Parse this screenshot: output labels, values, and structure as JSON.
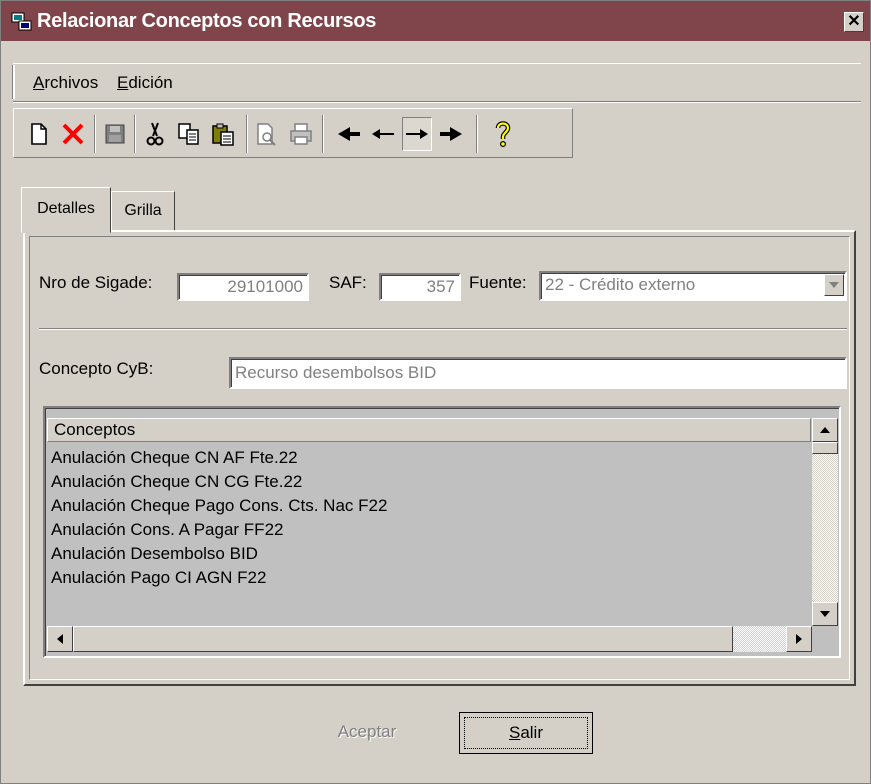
{
  "window": {
    "title": "Relacionar Conceptos con Recursos",
    "close_glyph": "✕"
  },
  "menu": {
    "archivos": {
      "mnemonic": "A",
      "rest": "rchivos"
    },
    "edicion": {
      "mnemonic": "E",
      "rest": "dición"
    }
  },
  "toolbar_icons": [
    "new-document-icon",
    "delete-icon",
    "save-icon",
    "cut-icon",
    "copy-icon",
    "paste-icon",
    "print-preview-icon",
    "print-icon",
    "first-record-icon",
    "previous-record-icon",
    "next-record-icon",
    "last-record-icon",
    "help-icon"
  ],
  "tabs": {
    "detalles": "Detalles",
    "grilla": "Grilla"
  },
  "form": {
    "nro_sigade_label": "Nro de Sigade:",
    "nro_sigade_value": "29101000",
    "saf_label": "SAF:",
    "saf_value": "357",
    "fuente_label": "Fuente:",
    "fuente_value": "22 - Crédito externo",
    "concepto_label": "Concepto CyB:",
    "concepto_value": "Recurso desembolsos BID"
  },
  "grid": {
    "header": "Conceptos",
    "rows": [
      "Anulación Cheque CN AF Fte.22",
      "Anulación Cheque CN CG Fte.22",
      "Anulación Cheque Pago Cons. Cts. Nac F22",
      "Anulación Cons. A Pagar FF22",
      "Anulación Desembolso BID",
      "Anulación Pago CI AGN F22"
    ]
  },
  "buttons": {
    "aceptar": {
      "mnemonic": "A",
      "rest": "ceptar"
    },
    "salir": {
      "mnemonic": "S",
      "rest": "alir"
    }
  },
  "colors": {
    "titlebar": "#80454a",
    "face": "#d4d0c8",
    "grid_bg": "#c0c0c0"
  }
}
